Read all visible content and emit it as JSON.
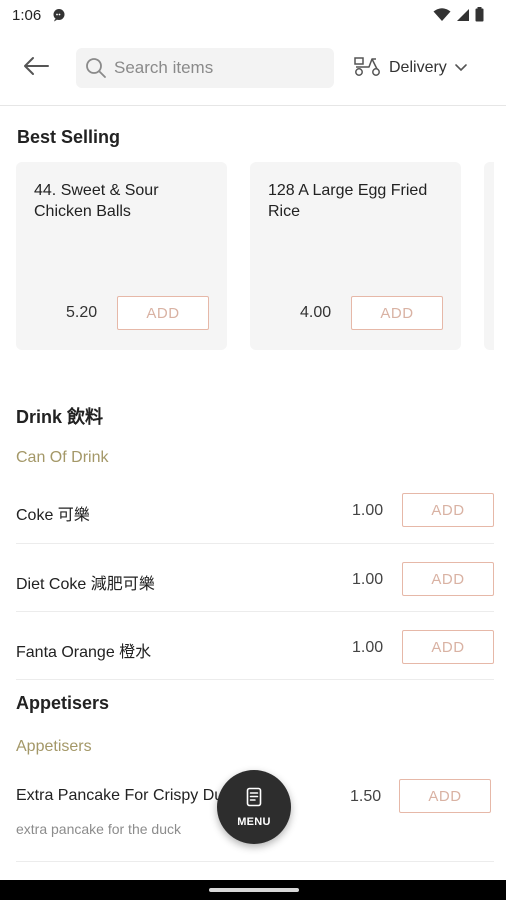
{
  "status_bar": {
    "time": "1:06"
  },
  "search": {
    "placeholder": "Search items"
  },
  "delivery": {
    "label": "Delivery"
  },
  "best_selling": {
    "title": "Best Selling",
    "items": [
      {
        "name": "44. Sweet & Sour Chicken Balls",
        "price": "5.20",
        "add_label": "ADD"
      },
      {
        "name": "128 A Large Egg Fried Rice",
        "price": "4.00",
        "add_label": "ADD"
      }
    ]
  },
  "categories": [
    {
      "title": "Drink 飲料",
      "subcategory": "Can Of Drink",
      "items": [
        {
          "name": "Coke 可樂",
          "price": "1.00",
          "add_label": "ADD"
        },
        {
          "name": "Diet Coke 減肥可樂",
          "price": "1.00",
          "add_label": "ADD"
        },
        {
          "name": "Fanta Orange 橙水",
          "price": "1.00",
          "add_label": "ADD"
        }
      ]
    },
    {
      "title": "Appetisers",
      "subcategory": "Appetisers",
      "items": [
        {
          "name": "Extra Pancake For Crispy Duck 鴨",
          "description": "extra pancake for the duck",
          "price": "1.50",
          "add_label": "ADD"
        }
      ]
    }
  ],
  "fab": {
    "label": "MENU"
  }
}
